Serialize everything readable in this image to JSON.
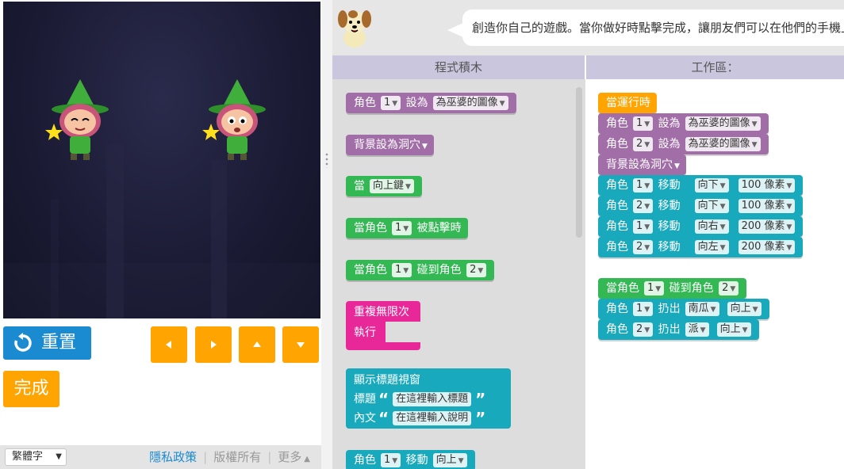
{
  "controls": {
    "reset_label": "重置",
    "finish_label": "完成"
  },
  "footer": {
    "language": "繁體字",
    "privacy": "隱私政策",
    "copyright": "版權所有",
    "more": "更多"
  },
  "instructions": {
    "text": "創造你自己的遊戲。當你做好時點擊完成，讓朋友們可以在他們的手機上試玩！"
  },
  "headers": {
    "toolbox": "程式積木",
    "workspace": "工作區："
  },
  "toolbox": {
    "b1": {
      "pre": "角色",
      "n": "1",
      "mid": "設為",
      "val": "為巫婆的圖像"
    },
    "b2": {
      "pre": "背景設為洞穴"
    },
    "b3": {
      "pre": "當",
      "val": "向上鍵"
    },
    "b4": {
      "pre": "當角色",
      "n": "1",
      "post": "被點擊時"
    },
    "b5": {
      "pre": "當角色",
      "n": "1",
      "post": "碰到角色",
      "n2": "2"
    },
    "b6": {
      "line1": "重複無限次",
      "line2": "執行"
    },
    "b7": {
      "title": "顯示標題視窗",
      "label_title": "標題",
      "val_title": "在這裡輸入標題",
      "label_body": "內文",
      "val_body": "在這裡輸入說明"
    },
    "b8": {
      "pre": "角色",
      "n": "1",
      "mid": "移動",
      "val": "向上"
    }
  },
  "workspace": {
    "s1": {
      "label": "當運行時"
    },
    "s2": {
      "pre": "角色",
      "n": "1",
      "mid": "設為",
      "val": "為巫婆的圖像"
    },
    "s3": {
      "pre": "角色",
      "n": "2",
      "mid": "設為",
      "val": "為巫婆的圖像"
    },
    "s4": {
      "label": "背景設為洞穴"
    },
    "s5": {
      "pre": "角色",
      "n": "1",
      "mid": "移動",
      "dir": "向下",
      "dist": "100 像素"
    },
    "s6": {
      "pre": "角色",
      "n": "2",
      "mid": "移動",
      "dir": "向下",
      "dist": "100 像素"
    },
    "s7": {
      "pre": "角色",
      "n": "1",
      "mid": "移動",
      "dir": "向右",
      "dist": "200 像素"
    },
    "s8": {
      "pre": "角色",
      "n": "2",
      "mid": "移動",
      "dir": "向左",
      "dist": "200 像素"
    },
    "s9": {
      "pre": "當角色",
      "n": "1",
      "post": "碰到角色",
      "n2": "2"
    },
    "s10": {
      "pre": "角色",
      "n": "1",
      "mid": "扔出",
      "item": "南瓜",
      "dir": "向上"
    },
    "s11": {
      "pre": "角色",
      "n": "2",
      "mid": "扔出",
      "item": "派",
      "dir": "向上"
    }
  },
  "colors": {
    "reset": "#1a8bd1",
    "orange": "#ffa400",
    "purple_block": "#a26ea8",
    "green_block": "#33b854",
    "teal_block": "#19a9bd",
    "pink_block": "#e82799",
    "header_bar": "#c9c6dd"
  },
  "icons": [
    "reset-icon",
    "left-arrow-icon",
    "right-arrow-icon",
    "up-arrow-icon",
    "down-arrow-icon",
    "dropdown-caret-icon",
    "dog-mascot-icon",
    "witch-sprite"
  ]
}
